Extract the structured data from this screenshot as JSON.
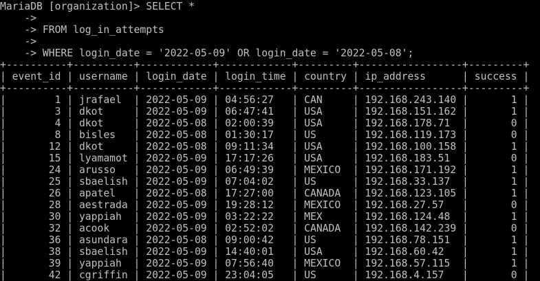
{
  "terminal": {
    "colors": {
      "background": "#000000",
      "foreground": "#c0c0c0"
    },
    "lines": [
      "MariaDB [organization]> SELECT *",
      "    ->",
      "    -> FROM log_in_attempts",
      "    ->",
      "    -> WHERE login_date = '2022-05-09' OR login_date = '2022-05-08';",
      "+----------+----------+------------+------------+---------+-----------------+---------+",
      "| event_id | username | login_date | login_time | country | ip_address      | success |",
      "+----------+----------+------------+------------+---------+-----------------+---------+",
      "|        1 | jrafael  | 2022-05-09 | 04:56:27   | CAN     | 192.168.243.140 |       1 |",
      "|        3 | dkot     | 2022-05-09 | 06:47:41   | USA     | 192.168.151.162 |       1 |",
      "|        4 | dkot     | 2022-05-08 | 02:00:39   | USA     | 192.168.178.71  |       0 |",
      "|        8 | bisles   | 2022-05-08 | 01:30:17   | US      | 192.168.119.173 |       0 |",
      "|       12 | dkot     | 2022-05-08 | 09:11:34   | USA     | 192.168.100.158 |       1 |",
      "|       15 | lyamamot | 2022-05-09 | 17:17:26   | USA     | 192.168.183.51  |       0 |",
      "|       24 | arusso   | 2022-05-09 | 06:49:39   | MEXICO  | 192.168.171.192 |       1 |",
      "|       25 | sbaelish | 2022-05-09 | 07:04:02   | US      | 192.168.33.137  |       1 |",
      "|       26 | apatel   | 2022-05-08 | 17:27:00   | CANADA  | 192.168.123.105 |       1 |",
      "|       28 | aestrada | 2022-05-09 | 19:28:12   | MEXICO  | 192.168.27.57   |       0 |",
      "|       30 | yappiah  | 2022-05-09 | 03:22:22   | MEX     | 192.168.124.48  |       1 |",
      "|       32 | acook    | 2022-05-09 | 02:52:02   | CANADA  | 192.168.142.239 |       0 |",
      "|       36 | asundara | 2022-05-08 | 09:00:42   | US      | 192.168.78.151  |       1 |",
      "|       38 | sbaelish | 2022-05-09 | 14:40:01   | USA     | 192.168.60.42   |       1 |",
      "|       39 | yappiah  | 2022-05-09 | 07:56:40   | MEXICO  | 192.168.57.115  |       1 |",
      "|       42 | cgriffin | 2022-05-09 | 23:04:05   | US      | 192.168.4.157   |       0 |"
    ]
  }
}
